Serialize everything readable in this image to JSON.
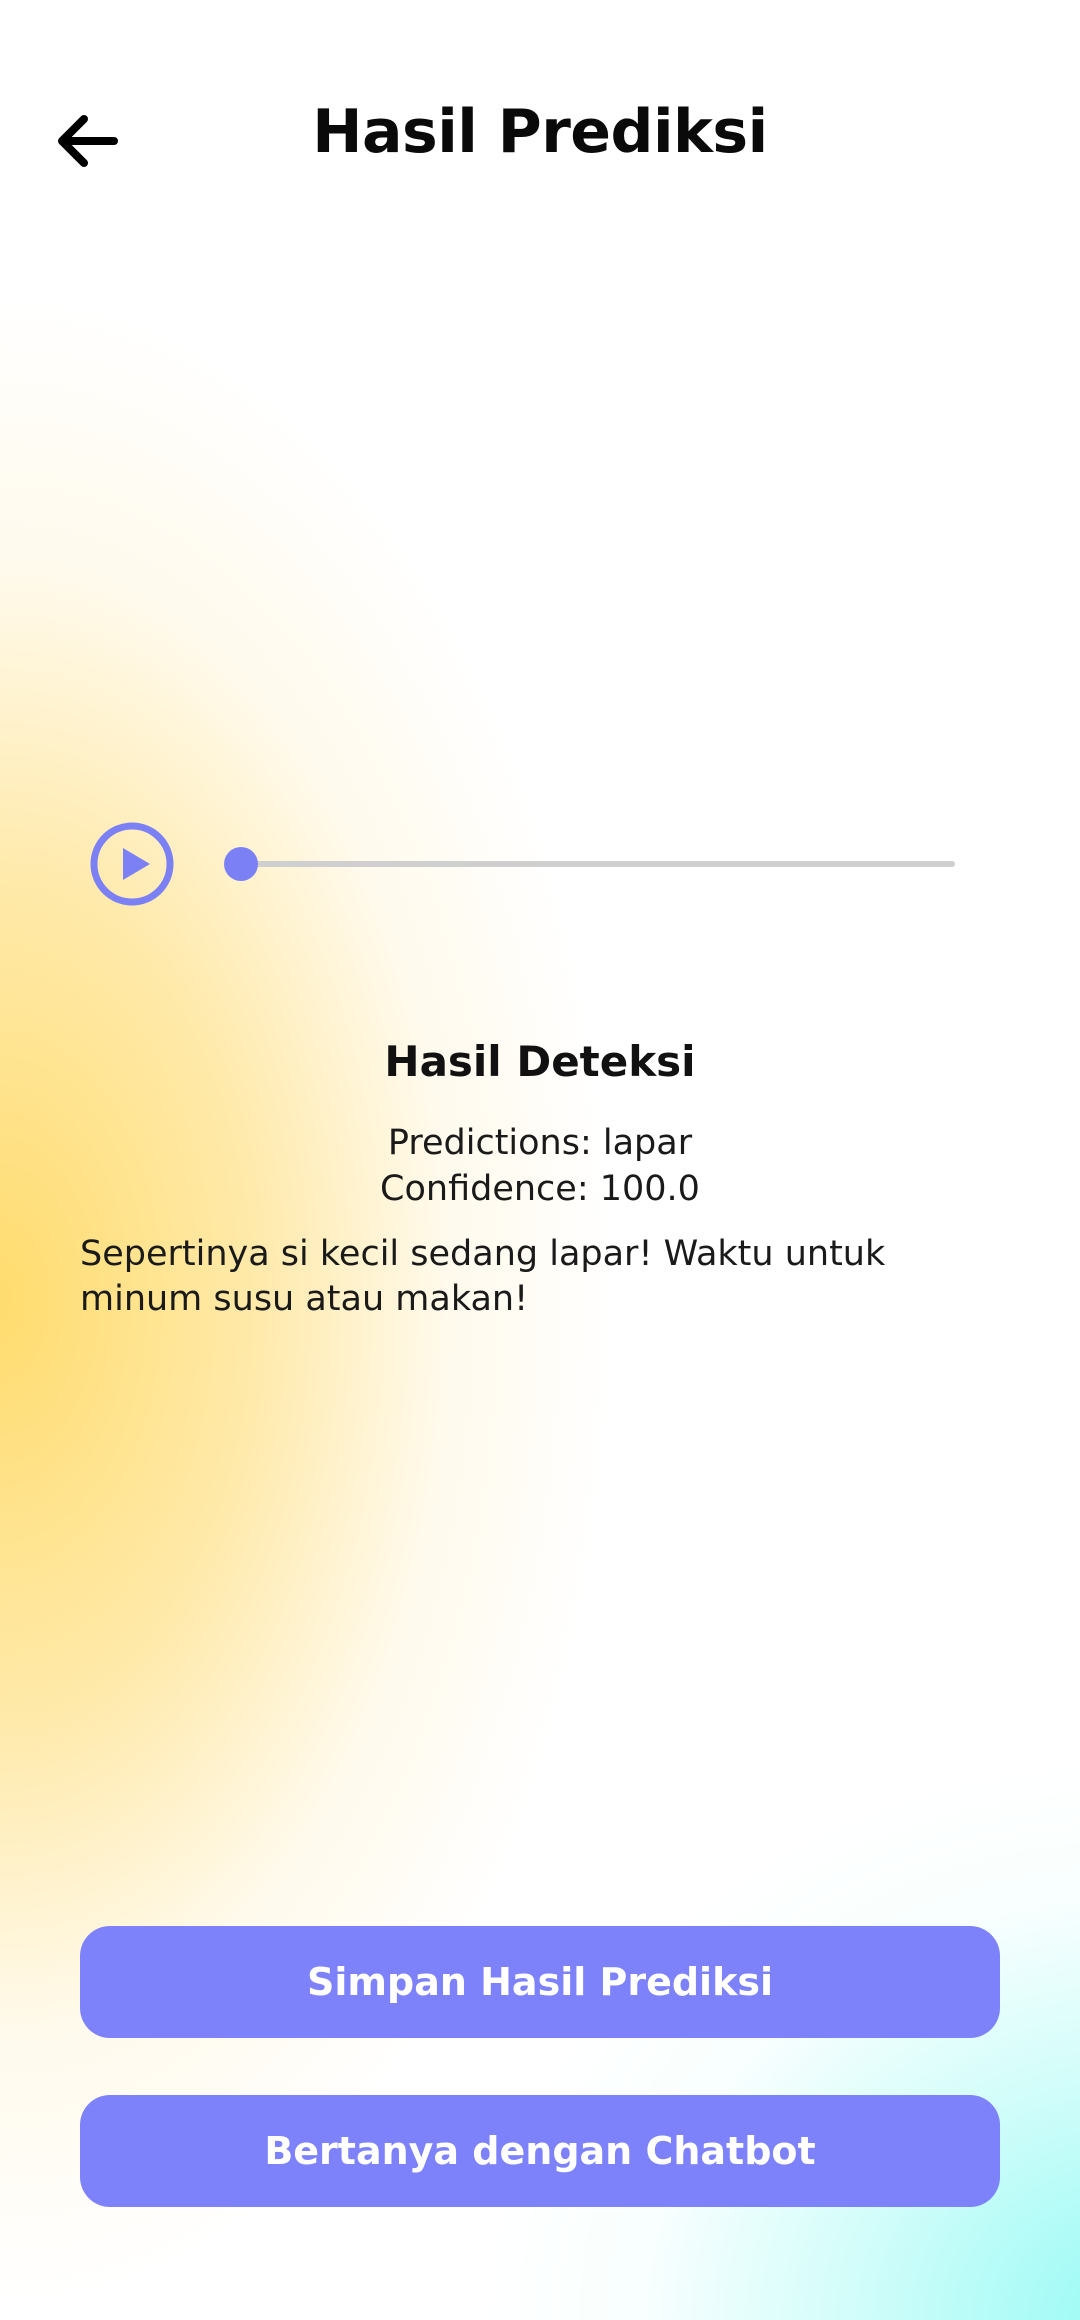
{
  "header": {
    "title": "Hasil Prediksi",
    "back_icon": "arrow-left-icon"
  },
  "player": {
    "play_icon": "play-circle-icon",
    "progress": 0,
    "accent_color": "#7b80f5"
  },
  "result": {
    "heading": "Hasil Deteksi",
    "prediction_text": "Predictions: lapar",
    "confidence_text": "Confidence: 100.0",
    "message": "Sepertinya si kecil sedang lapar! Waktu untuk minum susu atau makan!"
  },
  "actions": {
    "save_label": "Simpan Hasil Prediksi",
    "chat_label": "Bertanya dengan Chatbot",
    "button_color": "#7d82fb"
  }
}
